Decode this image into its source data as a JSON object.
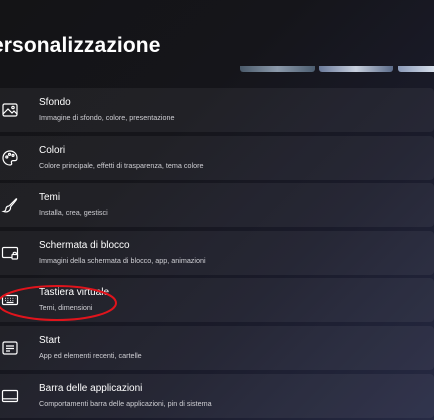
{
  "header": {
    "title": "ersonalizzazione"
  },
  "settings": {
    "items": [
      {
        "title": "Sfondo",
        "subtitle": "Immagine di sfondo, colore, presentazione",
        "icon": "image-icon"
      },
      {
        "title": "Colori",
        "subtitle": "Colore principale, effetti di trasparenza, tema colore",
        "icon": "palette-icon"
      },
      {
        "title": "Temi",
        "subtitle": "Installa, crea, gestisci",
        "icon": "brush-icon"
      },
      {
        "title": "Schermata di blocco",
        "subtitle": "Immagini della schermata di blocco, app, animazioni",
        "icon": "lock-screen-icon"
      },
      {
        "title": "Tastiera virtuale",
        "subtitle": "Temi, dimensioni",
        "icon": "keyboard-icon"
      },
      {
        "title": "Start",
        "subtitle": "App ed elementi recenti, cartelle",
        "icon": "start-icon"
      },
      {
        "title": "Barra delle applicazioni",
        "subtitle": "Comportamenti barra delle applicazioni, pin di sistema",
        "icon": "taskbar-icon"
      }
    ]
  },
  "colors": {
    "annotation": "#e0141c",
    "row_background": "rgba(255,255,255,0.055)"
  }
}
